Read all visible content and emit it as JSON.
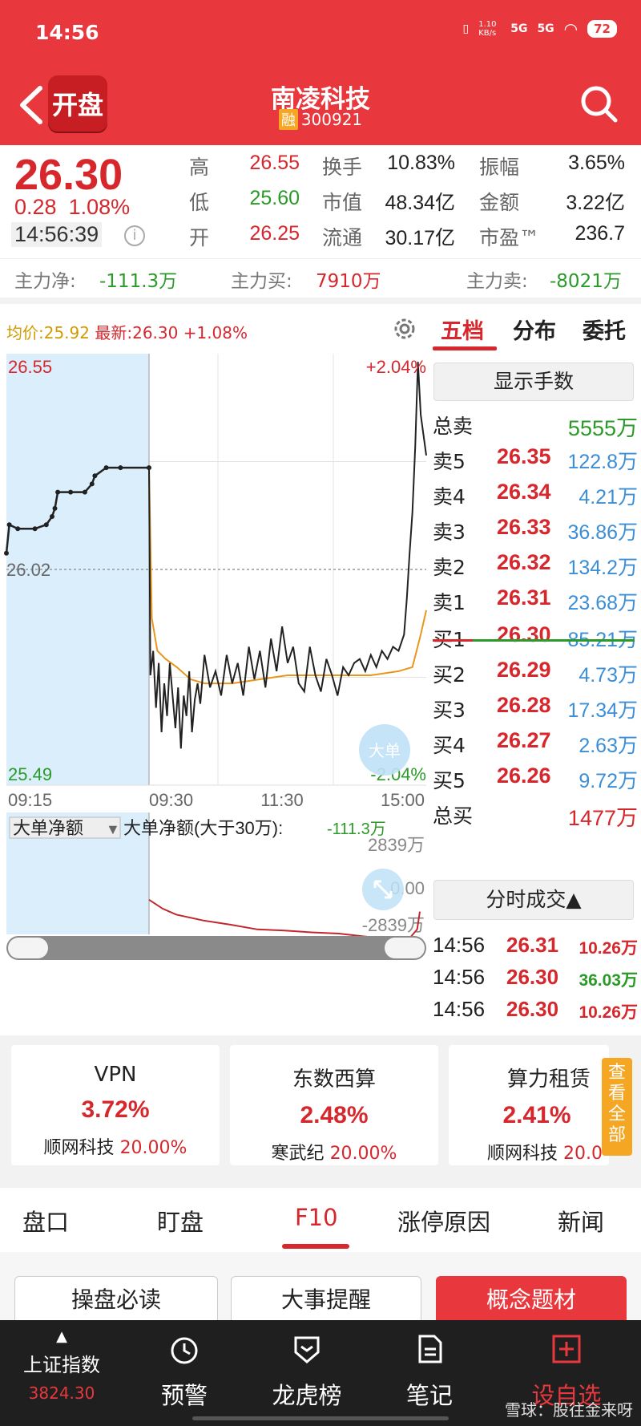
{
  "status_bar": {
    "time": "14:56",
    "net_speed": "1.10 KB/s",
    "sig1": "5G",
    "sig2": "5G",
    "battery": "72"
  },
  "header": {
    "logo_text": "开盘",
    "stock_name": "南凌科技",
    "margin_badge": "融",
    "stock_code": "300921"
  },
  "quote": {
    "price": "26.30",
    "change_abs": "0.28",
    "change_pct": "1.08%",
    "time": "14:56:39",
    "cells": [
      {
        "label": "高",
        "value": "26.55",
        "color": "#d6272d"
      },
      {
        "label": "换手",
        "value": "10.83%",
        "color": "#222222"
      },
      {
        "label": "振幅",
        "value": "3.65%",
        "color": "#222222"
      },
      {
        "label": "低",
        "value": "25.60",
        "color": "#2a9a28"
      },
      {
        "label": "市值",
        "value": "48.34亿",
        "color": "#222222"
      },
      {
        "label": "金额",
        "value": "3.22亿",
        "color": "#222222"
      },
      {
        "label": "开",
        "value": "26.25",
        "color": "#d6272d"
      },
      {
        "label": "流通",
        "value": "30.17亿",
        "color": "#222222"
      },
      {
        "label": "市盈™",
        "value": "236.7",
        "color": "#222222"
      }
    ],
    "main_net_label": "主力净:",
    "main_net": "-111.3万",
    "main_buy_label": "主力买:",
    "main_buy": "7910万",
    "main_sell_label": "主力卖:",
    "main_sell": "-8021万"
  },
  "chart_header": {
    "avg_label": "均价:25.92",
    "latest_label": "最新:26.30",
    "latest_pct": "+1.08%",
    "tabs": [
      "五档",
      "分布",
      "委托"
    ]
  },
  "chart_data": {
    "type": "line",
    "title": "",
    "ylim": [
      25.49,
      26.55
    ],
    "prev_close": 26.02,
    "y_labels": {
      "top": "26.55",
      "mid": "26.02",
      "bottom": "25.49",
      "top_pct": "+2.04%",
      "bottom_pct": "-2.04%"
    },
    "x_ticks": [
      "09:15",
      "09:30",
      "11:30",
      "15:00"
    ],
    "series": [],
    "auction_price": [
      [
        0,
        26.06
      ],
      [
        0.02,
        26.13
      ],
      [
        0.08,
        26.12
      ],
      [
        0.2,
        26.12
      ],
      [
        0.28,
        26.13
      ],
      [
        0.32,
        26.15
      ],
      [
        0.34,
        26.17
      ],
      [
        0.36,
        26.21
      ],
      [
        0.45,
        26.21
      ],
      [
        0.55,
        26.21
      ],
      [
        0.6,
        26.23
      ],
      [
        0.62,
        26.25
      ],
      [
        0.7,
        26.27
      ],
      [
        0.8,
        26.27
      ],
      [
        1.0,
        26.27
      ]
    ],
    "price": [
      [
        0,
        26.27
      ],
      [
        0.005,
        25.76
      ],
      [
        0.015,
        25.82
      ],
      [
        0.025,
        25.68
      ],
      [
        0.035,
        25.79
      ],
      [
        0.045,
        25.62
      ],
      [
        0.055,
        25.74
      ],
      [
        0.065,
        25.66
      ],
      [
        0.075,
        25.79
      ],
      [
        0.085,
        25.71
      ],
      [
        0.095,
        25.63
      ],
      [
        0.105,
        25.73
      ],
      [
        0.115,
        25.58
      ],
      [
        0.125,
        25.71
      ],
      [
        0.135,
        25.66
      ],
      [
        0.145,
        25.77
      ],
      [
        0.155,
        25.62
      ],
      [
        0.165,
        25.7
      ],
      [
        0.175,
        25.74
      ],
      [
        0.185,
        25.69
      ],
      [
        0.2,
        25.81
      ],
      [
        0.22,
        25.73
      ],
      [
        0.24,
        25.77
      ],
      [
        0.26,
        25.71
      ],
      [
        0.28,
        25.81
      ],
      [
        0.3,
        25.74
      ],
      [
        0.32,
        25.79
      ],
      [
        0.34,
        25.71
      ],
      [
        0.36,
        25.83
      ],
      [
        0.38,
        25.75
      ],
      [
        0.4,
        25.82
      ],
      [
        0.42,
        25.73
      ],
      [
        0.44,
        25.85
      ],
      [
        0.46,
        25.77
      ],
      [
        0.48,
        25.88
      ],
      [
        0.5,
        25.79
      ],
      [
        0.52,
        25.83
      ],
      [
        0.54,
        25.74
      ],
      [
        0.56,
        25.72
      ],
      [
        0.58,
        25.83
      ],
      [
        0.6,
        25.76
      ],
      [
        0.62,
        25.72
      ],
      [
        0.64,
        25.8
      ],
      [
        0.66,
        25.76
      ],
      [
        0.68,
        25.71
      ],
      [
        0.7,
        25.78
      ],
      [
        0.72,
        25.76
      ],
      [
        0.74,
        25.79
      ],
      [
        0.76,
        25.8
      ],
      [
        0.78,
        25.77
      ],
      [
        0.8,
        25.81
      ],
      [
        0.82,
        25.78
      ],
      [
        0.84,
        25.82
      ],
      [
        0.86,
        25.8
      ],
      [
        0.88,
        25.83
      ],
      [
        0.9,
        25.82
      ],
      [
        0.92,
        25.86
      ],
      [
        0.93,
        25.95
      ],
      [
        0.94,
        26.06
      ],
      [
        0.95,
        26.16
      ],
      [
        0.96,
        26.32
      ],
      [
        0.97,
        26.53
      ],
      [
        0.98,
        26.4
      ],
      [
        1.0,
        26.3
      ]
    ],
    "avg_price": [
      [
        0,
        26.27
      ],
      [
        0.01,
        25.9
      ],
      [
        0.03,
        25.82
      ],
      [
        0.06,
        25.8
      ],
      [
        0.1,
        25.78
      ],
      [
        0.15,
        25.75
      ],
      [
        0.2,
        25.74
      ],
      [
        0.3,
        25.74
      ],
      [
        0.4,
        25.75
      ],
      [
        0.5,
        25.76
      ],
      [
        0.6,
        25.76
      ],
      [
        0.7,
        25.76
      ],
      [
        0.8,
        25.76
      ],
      [
        0.9,
        25.77
      ],
      [
        0.95,
        25.78
      ],
      [
        0.98,
        25.86
      ],
      [
        1.0,
        25.92
      ]
    ],
    "big_order": {
      "label": "大单净额",
      "desc": "大单净额(大于30万):",
      "value": "-111.3万",
      "top": "2839万",
      "zero": "0.00",
      "bottom": "-2839万",
      "values": [
        [
          0,
          -0.2
        ],
        [
          0.05,
          -0.35
        ],
        [
          0.1,
          -0.45
        ],
        [
          0.2,
          -0.55
        ],
        [
          0.3,
          -0.62
        ],
        [
          0.4,
          -0.7
        ],
        [
          0.5,
          -0.72
        ],
        [
          0.6,
          -0.75
        ],
        [
          0.7,
          -0.77
        ],
        [
          0.8,
          -0.82
        ],
        [
          0.88,
          -0.86
        ],
        [
          0.92,
          -0.88
        ],
        [
          0.96,
          -0.86
        ],
        [
          0.99,
          -0.7
        ],
        [
          1.0,
          -0.4
        ]
      ]
    }
  },
  "orderbook": {
    "show_qty": "显示手数",
    "total_sell_label": "总卖",
    "total_sell": "5555万",
    "sells": [
      {
        "label": "卖5",
        "price": "26.35",
        "vol": "122.8万"
      },
      {
        "label": "卖4",
        "price": "26.34",
        "vol": "4.21万"
      },
      {
        "label": "卖3",
        "price": "26.33",
        "vol": "36.86万"
      },
      {
        "label": "卖2",
        "price": "26.32",
        "vol": "134.2万"
      },
      {
        "label": "卖1",
        "price": "26.31",
        "vol": "23.68万"
      }
    ],
    "buys": [
      {
        "label": "买1",
        "price": "26.30",
        "vol": "85.21万"
      },
      {
        "label": "买2",
        "price": "26.29",
        "vol": "4.73万"
      },
      {
        "label": "买3",
        "price": "26.28",
        "vol": "17.34万"
      },
      {
        "label": "买4",
        "price": "26.27",
        "vol": "2.63万"
      },
      {
        "label": "买5",
        "price": "26.26",
        "vol": "9.72万"
      }
    ],
    "total_buy_label": "总买",
    "total_buy": "1477万",
    "fenshi_label": "分时成交▲",
    "trades": [
      {
        "time": "14:56",
        "price": "26.31",
        "vol": "10.26万",
        "color": "#d6272d"
      },
      {
        "time": "14:56",
        "price": "26.30",
        "vol": "36.03万",
        "color": "#2a9a28"
      },
      {
        "time": "14:56",
        "price": "26.30",
        "vol": "10.26万",
        "color": "#d6272d"
      }
    ]
  },
  "big_order_bubble": "大单",
  "concepts": [
    {
      "name": "VPN",
      "pct": "3.72%",
      "lead": "顺网科技",
      "lead_pct": "20.00%"
    },
    {
      "name": "东数西算",
      "pct": "2.48%",
      "lead": "寒武纪",
      "lead_pct": "20.00%"
    },
    {
      "name": "算力租赁",
      "pct": "2.41%",
      "lead": "顺网科技",
      "lead_pct": "20.0"
    }
  ],
  "view_all": "查看全部",
  "subtabs": [
    "盘口",
    "盯盘",
    "F10",
    "涨停原因",
    "新闻"
  ],
  "buttons": [
    "操盘必读",
    "大事提醒",
    "概念题材"
  ],
  "bottom_nav": {
    "index_name": "上证指数",
    "index_value": "3824.30",
    "items": [
      "预警",
      "龙虎榜",
      "笔记",
      "设自选"
    ]
  },
  "watermark": "雪球：股往金来呀"
}
